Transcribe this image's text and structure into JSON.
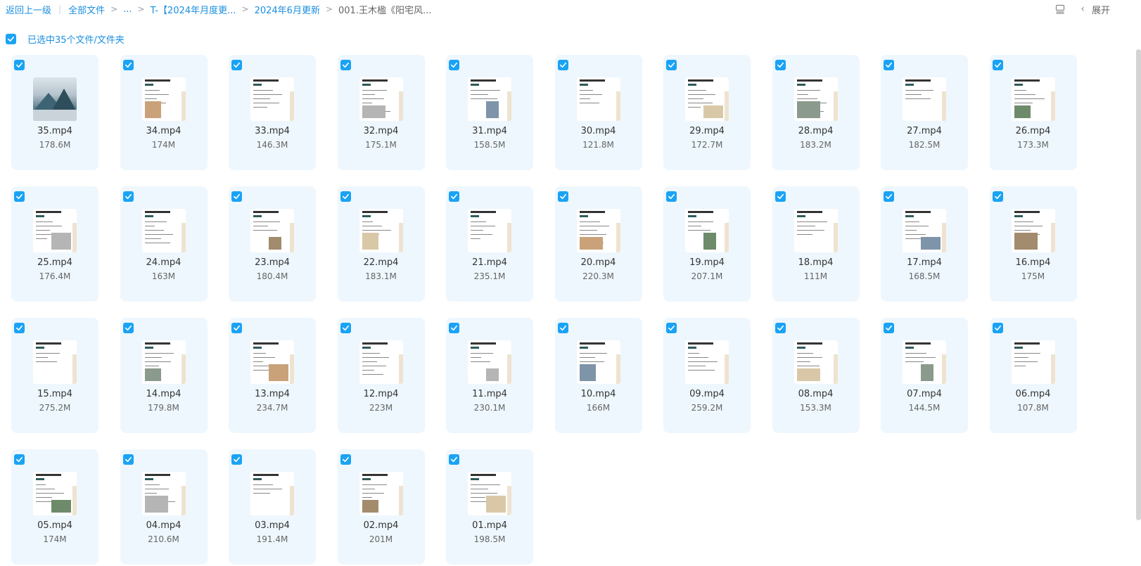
{
  "breadcrumb": {
    "back": "返回上一级",
    "all_files": "全部文件",
    "ellipsis": "...",
    "folder1": "T-【2024年月度更...",
    "folder2": "2024年6月更新",
    "current": "001.王木楹《阳宅风..."
  },
  "toolbar": {
    "list_view_icon": "list-view-icon",
    "collapse_label": "展开"
  },
  "selection": {
    "label": "已选中35个文件/文件夹"
  },
  "colors": {
    "accent": "#1aa3f5",
    "card_bg": "#eef7fd",
    "link": "#1a8fe0"
  },
  "files": [
    {
      "name": "35.mp4",
      "size": "178.6M"
    },
    {
      "name": "34.mp4",
      "size": "174M"
    },
    {
      "name": "33.mp4",
      "size": "146.3M"
    },
    {
      "name": "32.mp4",
      "size": "175.1M"
    },
    {
      "name": "31.mp4",
      "size": "158.5M"
    },
    {
      "name": "30.mp4",
      "size": "121.8M"
    },
    {
      "name": "29.mp4",
      "size": "172.7M"
    },
    {
      "name": "28.mp4",
      "size": "183.2M"
    },
    {
      "name": "27.mp4",
      "size": "182.5M"
    },
    {
      "name": "26.mp4",
      "size": "173.3M"
    },
    {
      "name": "25.mp4",
      "size": "176.4M"
    },
    {
      "name": "24.mp4",
      "size": "163M"
    },
    {
      "name": "23.mp4",
      "size": "180.4M"
    },
    {
      "name": "22.mp4",
      "size": "183.1M"
    },
    {
      "name": "21.mp4",
      "size": "235.1M"
    },
    {
      "name": "20.mp4",
      "size": "220.3M"
    },
    {
      "name": "19.mp4",
      "size": "207.1M"
    },
    {
      "name": "18.mp4",
      "size": "111M"
    },
    {
      "name": "17.mp4",
      "size": "168.5M"
    },
    {
      "name": "16.mp4",
      "size": "175M"
    },
    {
      "name": "15.mp4",
      "size": "275.2M"
    },
    {
      "name": "14.mp4",
      "size": "179.8M"
    },
    {
      "name": "13.mp4",
      "size": "234.7M"
    },
    {
      "name": "12.mp4",
      "size": "223M"
    },
    {
      "name": "11.mp4",
      "size": "230.1M"
    },
    {
      "name": "10.mp4",
      "size": "166M"
    },
    {
      "name": "09.mp4",
      "size": "259.2M"
    },
    {
      "name": "08.mp4",
      "size": "153.3M"
    },
    {
      "name": "07.mp4",
      "size": "144.5M"
    },
    {
      "name": "06.mp4",
      "size": "107.8M"
    },
    {
      "name": "05.mp4",
      "size": "174M"
    },
    {
      "name": "04.mp4",
      "size": "210.6M"
    },
    {
      "name": "03.mp4",
      "size": "191.4M"
    },
    {
      "name": "02.mp4",
      "size": "201M"
    },
    {
      "name": "01.mp4",
      "size": "198.5M"
    }
  ]
}
